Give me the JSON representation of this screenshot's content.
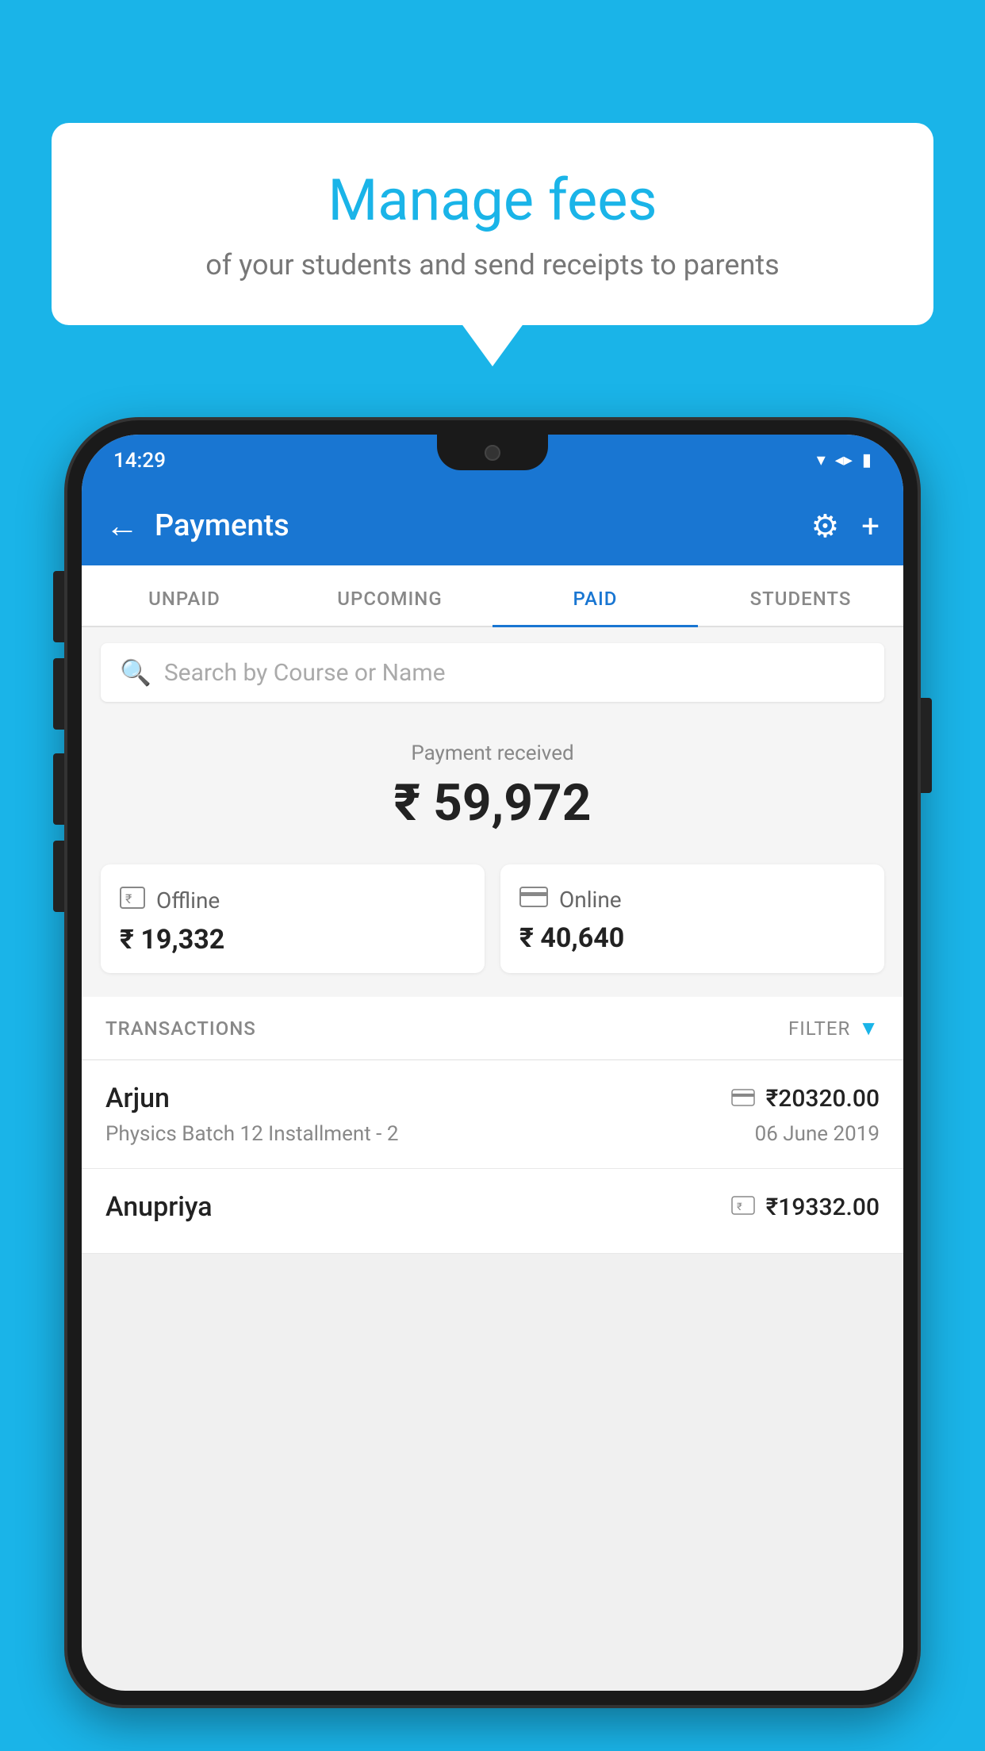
{
  "background_color": "#1ab4e8",
  "speech_bubble": {
    "title": "Manage fees",
    "subtitle": "of your students and send receipts to parents"
  },
  "status_bar": {
    "time": "14:29",
    "icons": [
      "wifi",
      "signal",
      "battery"
    ]
  },
  "app_bar": {
    "title": "Payments",
    "back_icon": "←",
    "settings_icon": "⚙",
    "add_icon": "+"
  },
  "tabs": [
    {
      "label": "UNPAID",
      "active": false
    },
    {
      "label": "UPCOMING",
      "active": false
    },
    {
      "label": "PAID",
      "active": true
    },
    {
      "label": "STUDENTS",
      "active": false
    }
  ],
  "search": {
    "placeholder": "Search by Course or Name"
  },
  "payment_received": {
    "label": "Payment received",
    "amount": "₹ 59,972"
  },
  "payment_cards": [
    {
      "icon": "offline",
      "type": "Offline",
      "amount": "₹ 19,332"
    },
    {
      "icon": "online",
      "type": "Online",
      "amount": "₹ 40,640"
    }
  ],
  "transactions": {
    "label": "TRANSACTIONS",
    "filter_label": "FILTER"
  },
  "transaction_items": [
    {
      "name": "Arjun",
      "course": "Physics Batch 12 Installment - 2",
      "amount": "₹20320.00",
      "date": "06 June 2019",
      "icon_type": "online"
    },
    {
      "name": "Anupriya",
      "course": "",
      "amount": "₹19332.00",
      "date": "",
      "icon_type": "offline"
    }
  ]
}
